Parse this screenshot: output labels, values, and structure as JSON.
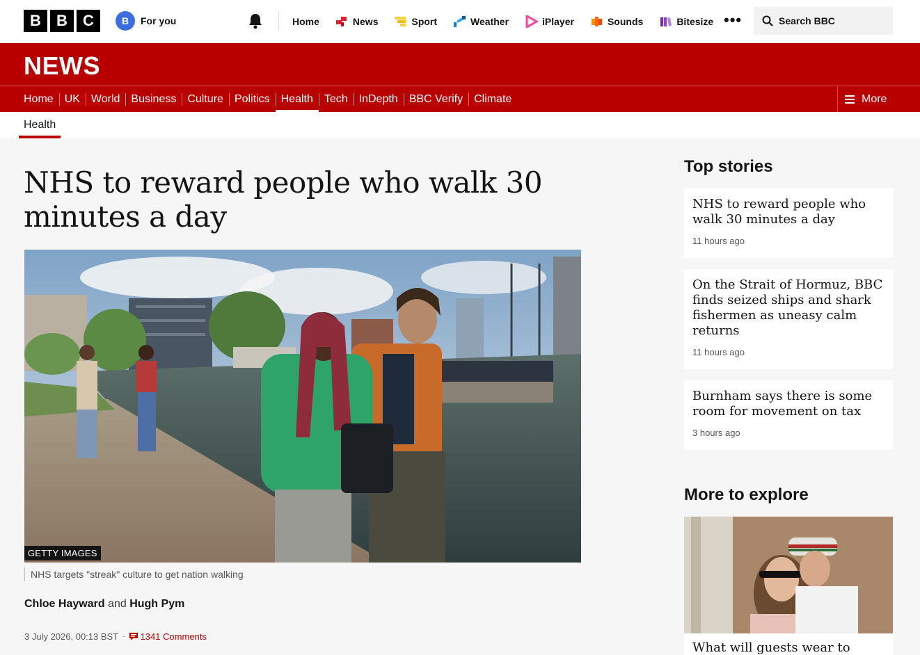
{
  "masthead": {
    "logo_letters": [
      "B",
      "B",
      "C"
    ],
    "for_you": {
      "avatar_letter": "B",
      "label": "For you"
    },
    "nav": [
      {
        "label": "Home",
        "icon": "none"
      },
      {
        "label": "News",
        "icon": "news-icon",
        "color": "#e4202c"
      },
      {
        "label": "Sport",
        "icon": "sport-icon",
        "color": "#ffd230"
      },
      {
        "label": "Weather",
        "icon": "weather-icon",
        "color": "#1381c9"
      },
      {
        "label": "iPlayer",
        "icon": "iplayer-icon",
        "color": "#f54997"
      },
      {
        "label": "Sounds",
        "icon": "sounds-icon",
        "color": "#ff6600"
      },
      {
        "label": "Bitesize",
        "icon": "bitesize-icon",
        "color": "#6a2ba8"
      }
    ],
    "more_dots": "•••",
    "search_placeholder": "Search BBC"
  },
  "news_brand": "NEWS",
  "subnav": {
    "links": [
      "Home",
      "UK",
      "World",
      "Business",
      "Culture",
      "Politics",
      "Health",
      "Tech",
      "InDepth",
      "BBC Verify",
      "Climate"
    ],
    "active": "Health",
    "more_label": "More"
  },
  "section_label": "Health",
  "article": {
    "headline": "NHS to reward people who walk 30 minutes a day",
    "image_credit": "GETTY IMAGES",
    "caption": "NHS targets \"streak\" culture to get nation walking",
    "author1": "Chloe Hayward",
    "byline_and": "and",
    "author2": "Hugh Pym",
    "date": "3 July 2026, 00:13 BST",
    "comments": "1341 Comments"
  },
  "sidebar": {
    "top_stories_title": "Top stories",
    "stories": [
      {
        "title": "NHS to reward people who walk 30 minutes a day",
        "ago": "11 hours ago"
      },
      {
        "title": "On the Strait of Hormuz, BBC finds seized ships and shark fishermen as uneasy calm returns",
        "ago": "11 hours ago"
      },
      {
        "title": "Burnham says there is some room for movement on tax",
        "ago": "3 hours ago"
      }
    ],
    "explore_title": "More to explore",
    "explore_story": "What will guests wear to"
  },
  "colors": {
    "brand_red": "#b80000",
    "text": "#141414",
    "muted": "#545658"
  }
}
